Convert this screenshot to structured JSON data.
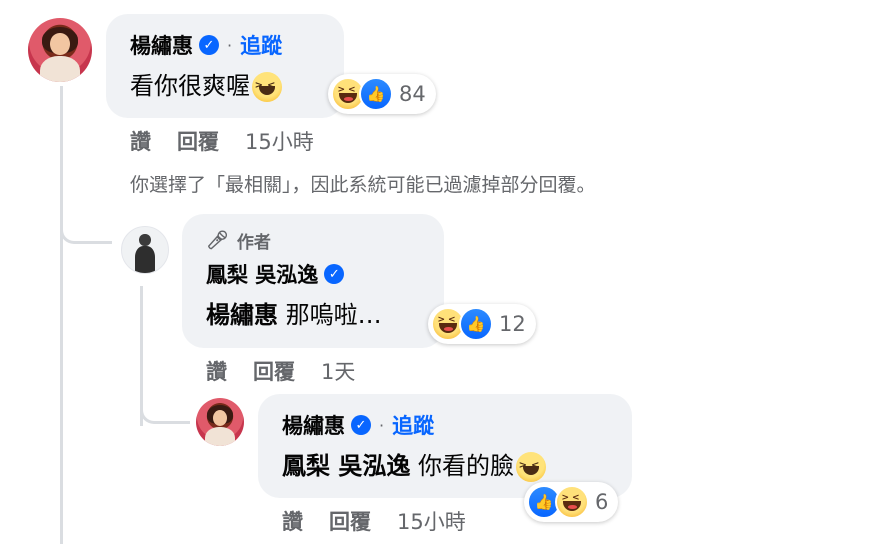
{
  "comment1": {
    "name": "楊繡惠",
    "separator": "·",
    "follow_label": "追蹤",
    "text": "看你很爽喔",
    "reaction_count": "84",
    "actions": {
      "like": "讚",
      "reply": "回覆",
      "time": "15小時"
    }
  },
  "notice": "你選擇了「最相關」，因此系統可能已過濾掉部分回覆。",
  "reply1": {
    "author_badge": "作者",
    "name": "鳳梨 吳泓逸",
    "mention": "楊繡惠",
    "text": "那嗚啦…",
    "reaction_count": "12",
    "actions": {
      "like": "讚",
      "reply": "回覆",
      "time": "1天"
    }
  },
  "reply2": {
    "name": "楊繡惠",
    "separator": "·",
    "follow_label": "追蹤",
    "mention": "鳳梨 吳泓逸",
    "text": "你看的臉",
    "reaction_count": "6",
    "actions": {
      "like": "讚",
      "reply": "回覆",
      "time": "15小時"
    }
  },
  "icons": {
    "verified": "verified-badge-icon",
    "author": "microphone-icon",
    "reactions": [
      "haha-reaction-icon",
      "like-reaction-icon"
    ],
    "emoji": "grinning-squinting-face-emoji"
  },
  "colors": {
    "accent": "#0866ff",
    "bubble": "#f0f2f5",
    "muted": "#65676b"
  }
}
